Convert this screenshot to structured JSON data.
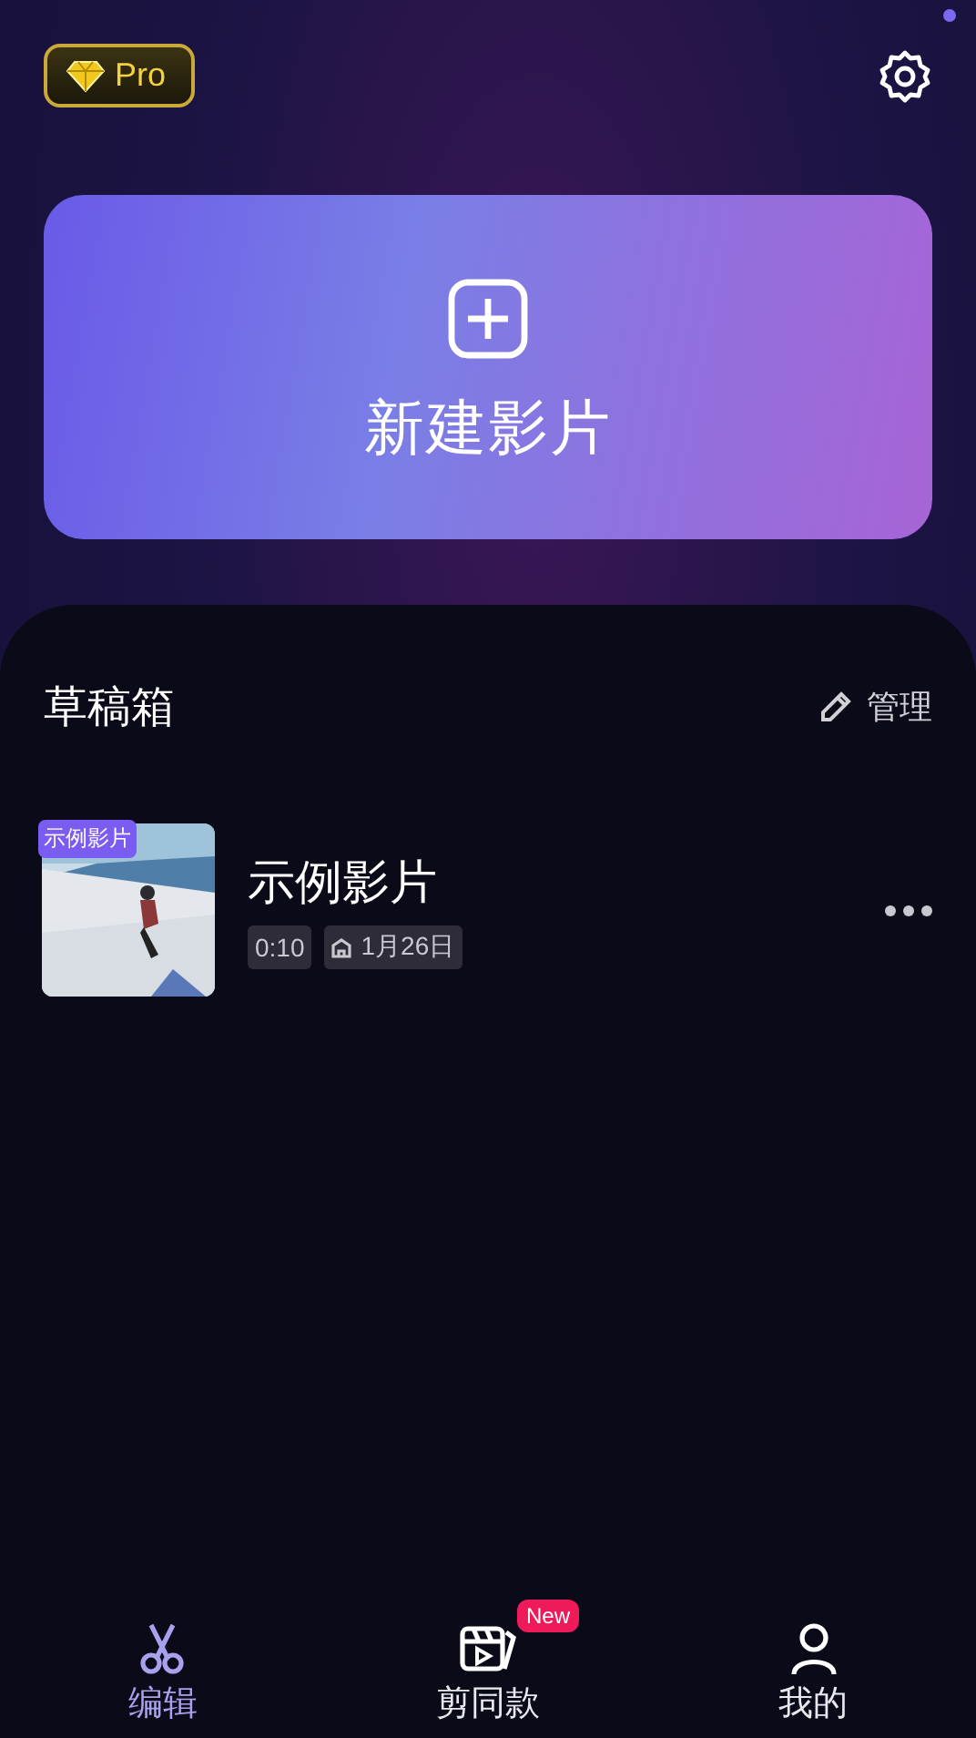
{
  "header": {
    "pro_badge": "Pro",
    "settings_has_dot": true
  },
  "new_project": {
    "label": "新建影片"
  },
  "drafts": {
    "title": "草稿箱",
    "manage": "管理",
    "items": [
      {
        "tag": "示例影片",
        "title": "示例影片",
        "duration": "0:10",
        "date": "1月26日"
      }
    ]
  },
  "bottom_nav": [
    {
      "label": "编辑",
      "kind": "scissors",
      "selected": true
    },
    {
      "label": "剪同款",
      "kind": "clapper",
      "selected": false,
      "badge": "New"
    },
    {
      "label": "我的",
      "kind": "person",
      "selected": false
    }
  ]
}
